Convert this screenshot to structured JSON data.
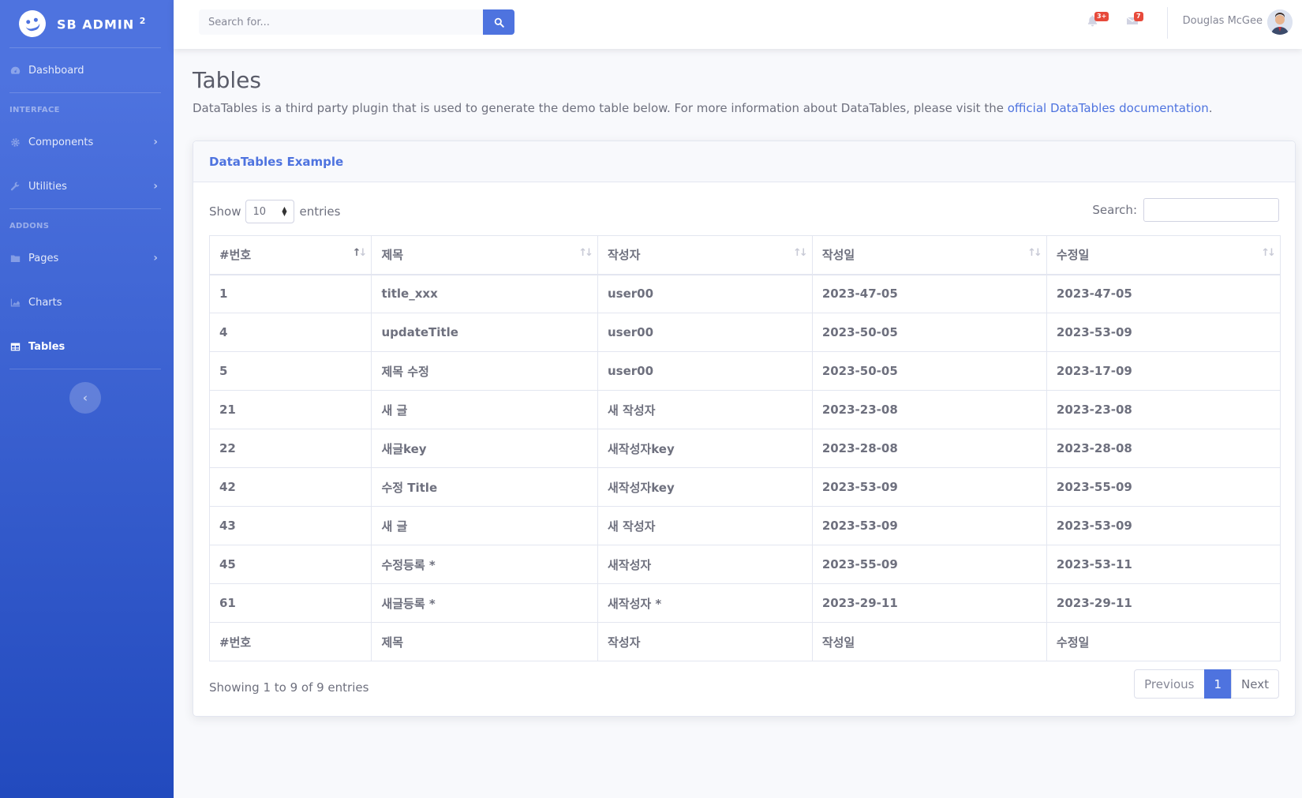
{
  "sidebar": {
    "brand": "SB ADMIN",
    "brand_sup": "2",
    "dashboard": "Dashboard",
    "heading_interface": "Interface",
    "components": "Components",
    "utilities": "Utilities",
    "heading_addons": "Addons",
    "pages": "Pages",
    "charts": "Charts",
    "tables": "Tables"
  },
  "topbar": {
    "search_placeholder": "Search for...",
    "alerts_badge": "3+",
    "messages_badge": "7",
    "user_name": "Douglas McGee"
  },
  "page": {
    "title": "Tables",
    "description": "DataTables is a third party plugin that is used to generate the demo table below. For more information about DataTables, please visit the ",
    "link_text": "official DataTables documentation",
    "description_end": "."
  },
  "card": {
    "title": "DataTables Example",
    "show_label": "Show",
    "entries_label": "entries",
    "length_value": "10",
    "search_label": "Search:",
    "columns": [
      "#번호",
      "제목",
      "작성자",
      "작성일",
      "수정일"
    ],
    "rows": [
      [
        "1",
        "title_xxx",
        "user00",
        "2023-47-05",
        "2023-47-05"
      ],
      [
        "4",
        "updateTitle",
        "user00",
        "2023-50-05",
        "2023-53-09"
      ],
      [
        "5",
        "제목 수정",
        "user00",
        "2023-50-05",
        "2023-17-09"
      ],
      [
        "21",
        "새 글",
        "새 작성자",
        "2023-23-08",
        "2023-23-08"
      ],
      [
        "22",
        "새글key",
        "새작성자key",
        "2023-28-08",
        "2023-28-08"
      ],
      [
        "42",
        "수정 Title",
        "새작성자key",
        "2023-53-09",
        "2023-55-09"
      ],
      [
        "43",
        "새 글",
        "새 작성자",
        "2023-53-09",
        "2023-53-09"
      ],
      [
        "45",
        "수정등록 *",
        "새작성자",
        "2023-55-09",
        "2023-53-11"
      ],
      [
        "61",
        "새글등록 *",
        "새작성자 *",
        "2023-29-11",
        "2023-29-11"
      ]
    ],
    "info": "Showing 1 to 9 of 9 entries",
    "prev": "Previous",
    "current_page": "1",
    "next": "Next"
  },
  "colors": {
    "primary": "#4e73df",
    "danger": "#e74a3b"
  }
}
